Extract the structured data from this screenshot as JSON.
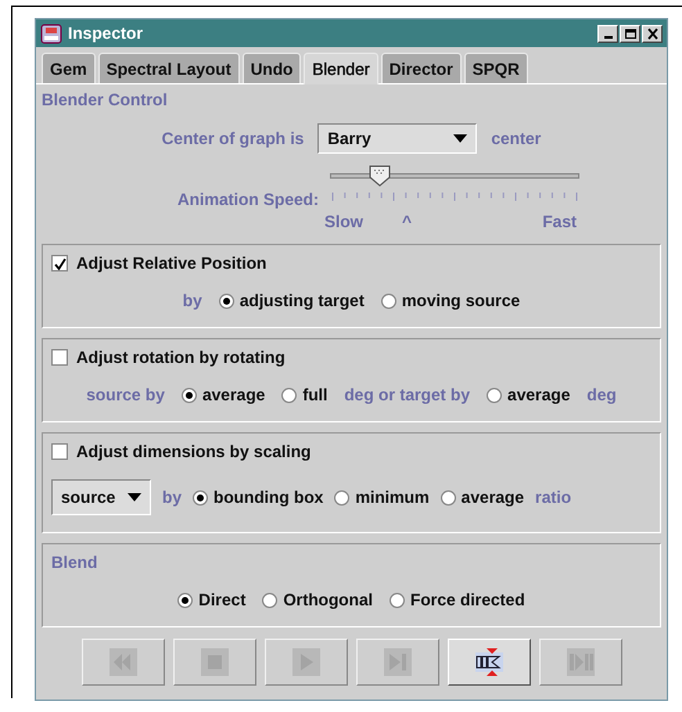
{
  "window": {
    "title": "Inspector"
  },
  "tabs": [
    {
      "label": "Gem",
      "selected": false
    },
    {
      "label": "Spectral Layout",
      "selected": false
    },
    {
      "label": "Undo",
      "selected": false
    },
    {
      "label": "Blender",
      "selected": true
    },
    {
      "label": "Director",
      "selected": false
    },
    {
      "label": "SPQR",
      "selected": false
    }
  ],
  "blender_control": {
    "title": "Blender Control",
    "center_label": "Center of graph is",
    "center_dropdown": "Barry",
    "center_suffix": "center",
    "speed_label": "Animation Speed:",
    "speed": {
      "level": 0.2
    },
    "slow_label": "Slow",
    "marker": "^",
    "fast_label": "Fast"
  },
  "groups": [
    {
      "label": "Adjust Relative Position",
      "checked": true,
      "items": [
        {
          "kind": "label",
          "text": "by"
        },
        {
          "kind": "radio",
          "text": "adjusting target",
          "selected": true
        },
        {
          "kind": "radio",
          "text": "moving source",
          "selected": false
        }
      ]
    },
    {
      "label": "Adjust rotation by rotating",
      "checked": false,
      "items": [
        {
          "kind": "label",
          "text": "source by"
        },
        {
          "kind": "radio",
          "text": "average",
          "selected": true
        },
        {
          "kind": "radio",
          "text": "full",
          "selected": false
        },
        {
          "kind": "label",
          "text": "deg or target by"
        },
        {
          "kind": "radio",
          "text": "average",
          "selected": false
        },
        {
          "kind": "label",
          "text": "deg"
        }
      ]
    },
    {
      "label": "Adjust dimensions by scaling",
      "checked": false,
      "items": [
        {
          "kind": "dropdown",
          "text": "source"
        },
        {
          "kind": "label",
          "text": "by"
        },
        {
          "kind": "radio",
          "text": "bounding box",
          "selected": true
        },
        {
          "kind": "radio",
          "text": "minimum",
          "selected": false
        },
        {
          "kind": "radio",
          "text": "average",
          "selected": false
        },
        {
          "kind": "label",
          "text": "ratio"
        }
      ]
    }
  ],
  "blend": {
    "title": "Blend",
    "options": [
      {
        "text": "Direct",
        "selected": true
      },
      {
        "text": "Orthogonal",
        "selected": false
      },
      {
        "text": "Force directed",
        "selected": false
      }
    ]
  },
  "buttons": [
    {
      "kind": "rewind",
      "disabled": true
    },
    {
      "kind": "stop",
      "disabled": true
    },
    {
      "kind": "play",
      "disabled": true
    },
    {
      "kind": "step",
      "disabled": true
    },
    {
      "kind": "blend",
      "disabled": false
    },
    {
      "kind": "step-end",
      "disabled": true
    }
  ]
}
